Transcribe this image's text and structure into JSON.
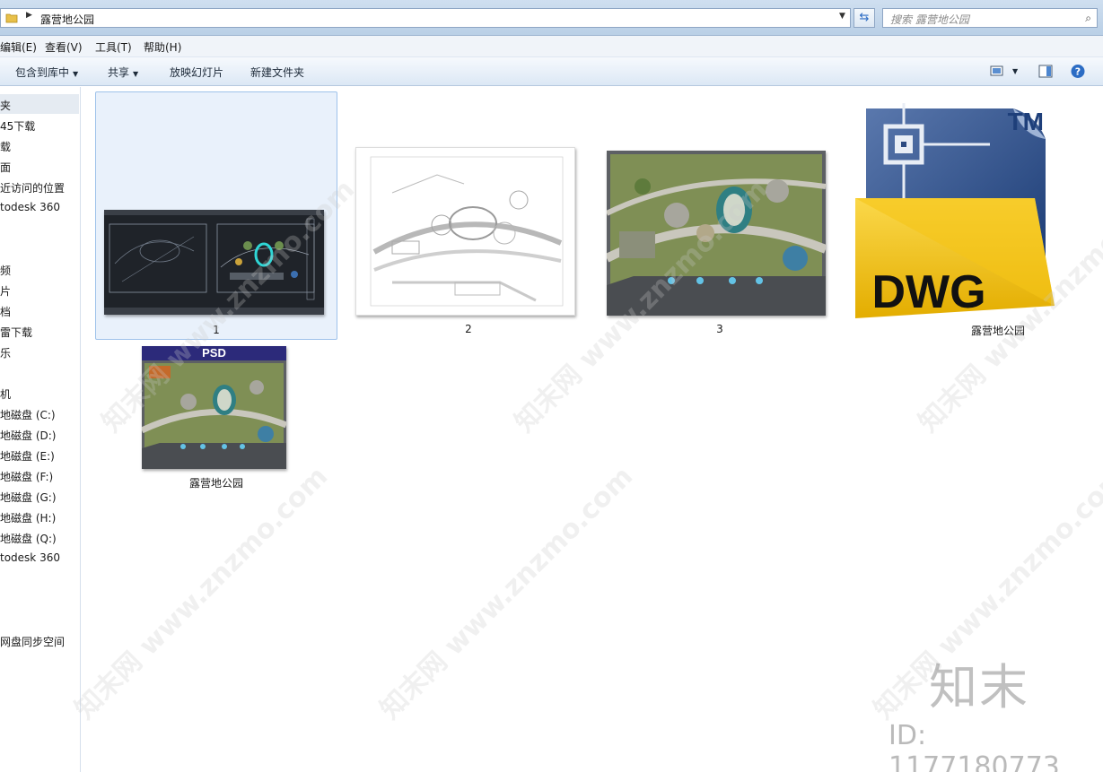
{
  "address": {
    "path": "露营地公园",
    "search_placeholder": "搜索 露营地公园"
  },
  "menu": [
    {
      "label": "编辑(E)"
    },
    {
      "label": "查看(V)"
    },
    {
      "label": "工具(T)"
    },
    {
      "label": "帮助(H)"
    }
  ],
  "toolbar": {
    "include_library": "包含到库中",
    "share": "共享",
    "slideshow": "放映幻灯片",
    "new_folder": "新建文件夹"
  },
  "sidebar": {
    "items": [
      {
        "label": "夹",
        "selected": true
      },
      {
        "label": "45下载"
      },
      {
        "label": "载"
      },
      {
        "label": "面"
      },
      {
        "label": "近访问的位置"
      },
      {
        "label": "todesk 360"
      },
      {
        "label": "频"
      },
      {
        "label": "片"
      },
      {
        "label": "档"
      },
      {
        "label": "雷下载"
      },
      {
        "label": "乐"
      },
      {
        "label": "机"
      },
      {
        "label": "地磁盘 (C:)"
      },
      {
        "label": "地磁盘 (D:)"
      },
      {
        "label": "地磁盘 (E:)"
      },
      {
        "label": "地磁盘 (F:)"
      },
      {
        "label": "地磁盘 (G:)"
      },
      {
        "label": "地磁盘 (H:)"
      },
      {
        "label": "地磁盘 (Q:)"
      },
      {
        "label": "todesk 360"
      },
      {
        "label": "网盘同步空间"
      }
    ]
  },
  "files": [
    {
      "name": "1",
      "type": "cad-dark-preview",
      "selected": true
    },
    {
      "name": "2",
      "type": "cad-line-drawing"
    },
    {
      "name": "3",
      "type": "color-plan"
    },
    {
      "name": "露营地公园",
      "type": "dwg-icon",
      "icon_text": "DWG",
      "tm": "TM"
    },
    {
      "name": "露营地公园",
      "type": "psd-preview",
      "badge": "PSD"
    }
  ],
  "watermark": {
    "brand": "知末",
    "id": "ID: 1177180773",
    "diagonal": "知末网 www.znzmo.com"
  },
  "colors": {
    "selection_bg": "#e9f1fb",
    "selection_border": "#9ec2ea",
    "dwg_yellow": "#f3c300",
    "dwg_blue": "#1e3f7a",
    "psd_purple": "#2c2a7a"
  }
}
